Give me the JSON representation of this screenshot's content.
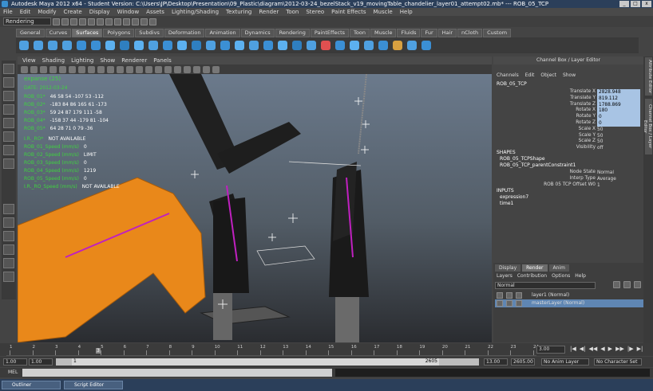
{
  "title_bar": {
    "text": "Autodesk Maya 2012 x64 - Student Version: C:\\Users\\JP\\Desktop\\Presentation\\09_Plastic\\diagram\\2012-03-24_bezelStack_v19_movingTable_chandelier_layer01_attempt02.mb* --- ROB_05_TCP",
    "buttons": [
      "_",
      "□",
      "x"
    ]
  },
  "menu_bar": [
    "File",
    "Edit",
    "Modify",
    "Create",
    "Display",
    "Window",
    "Assets",
    "Lighting/Shading",
    "Texturing",
    "Render",
    "Toon",
    "Stereo",
    "Paint Effects",
    "Muscle",
    "Help"
  ],
  "mode_menu": {
    "value": "Rendering"
  },
  "shelf_tabs": [
    "General",
    "Curves",
    "Surfaces",
    "Polygons",
    "Subdivs",
    "Deformation",
    "Animation",
    "Dynamics",
    "Rendering",
    "PaintEffects",
    "Toon",
    "Muscle",
    "Fluids",
    "Fur",
    "Hair",
    "nCloth",
    "Custom"
  ],
  "shelf_active_tab": "Surfaces",
  "shelf_icon_colors": [
    "#4fa0e0",
    "#4fa0e0",
    "#4fa0e0",
    "#4fa0e0",
    "#3b8fd4",
    "#3b8fd4",
    "#5cb0ef",
    "#2f7fc0",
    "#5cb0ef",
    "#4fa0e0",
    "#3b8fd4",
    "#5cb0ef",
    "#2f7fc0",
    "#4fa0e0",
    "#3b8fd4",
    "#5cb0ef",
    "#4fa0e0",
    "#3b8fd4",
    "#5cb0ef",
    "#2f7fc0",
    "#4fa0e0",
    "#e05050",
    "#3b8fd4",
    "#5cb0ef",
    "#4fa0e0",
    "#3b8fd4",
    "#d8a040",
    "#4fa0e0",
    "#3b8fd4"
  ],
  "panel_menu": [
    "View",
    "Shading",
    "Lighting",
    "Show",
    "Renderer",
    "Panels"
  ],
  "hud": {
    "title": "expanse (25)",
    "date": "DATE: 2012-03-24",
    "rob_rows": [
      {
        "label": "ROB_01*",
        "values": "46   58   54   -107   53   -112"
      },
      {
        "label": "ROB_02*",
        "values": "-183   84   86   165   61   -173"
      },
      {
        "label": "ROB_03*",
        "values": "59   24   87   179   111   -58"
      },
      {
        "label": "ROB_04*",
        "values": "-158   37   44   -179   81   -104"
      },
      {
        "label": "ROB_05*",
        "values": "64   28   71   0   79   -36"
      }
    ],
    "status_rows": [
      {
        "label": "I.R._RO*",
        "value": "NOT AVAILABLE"
      },
      {
        "label": "ROB_01_Speed (mm/s)",
        "value": "0"
      },
      {
        "label": "ROB_02_Speed (mm/s)",
        "value": "LIMIT"
      },
      {
        "label": "ROB_03_Speed (mm/s)",
        "value": "0"
      },
      {
        "label": "ROB_04_Speed (mm/s)",
        "value": "1219"
      },
      {
        "label": "ROB_05_Speed (mm/s)",
        "value": "0"
      },
      {
        "label": "I.R._RO_Speed (mm/s)",
        "value": "NOT AVAILABLE"
      }
    ]
  },
  "channel_box": {
    "header": "Channel Box / Layer Editor",
    "menu": [
      "Channels",
      "Edit",
      "Object",
      "Show"
    ],
    "object_name": "ROB_05_TCP",
    "channels": [
      {
        "label": "Translate X",
        "value": "2828.948",
        "highlight": true
      },
      {
        "label": "Translate Y",
        "value": "819.112",
        "highlight": true
      },
      {
        "label": "Translate Z",
        "value": "1788.869",
        "highlight": true
      },
      {
        "label": "Rotate X",
        "value": "180",
        "highlight": true
      },
      {
        "label": "Rotate Y",
        "value": "0",
        "highlight": true
      },
      {
        "label": "Rotate Z",
        "value": "0",
        "highlight": true
      },
      {
        "label": "Scale X",
        "value": "50",
        "highlight": false
      },
      {
        "label": "Scale Y",
        "value": "50",
        "highlight": false
      },
      {
        "label": "Scale Z",
        "value": "50",
        "highlight": false
      },
      {
        "label": "Visibility",
        "value": "off",
        "highlight": false
      }
    ],
    "shapes_header": "SHAPES",
    "shapes": [
      "ROB_05_TCPShape",
      "ROB_05_TCP_parentConstraint1"
    ],
    "constraint_attrs": [
      {
        "label": "Node State",
        "value": "Normal"
      },
      {
        "label": "Interp Type",
        "value": "Average"
      },
      {
        "label": "ROB 05 TCP Offset W0",
        "value": "1"
      }
    ],
    "inputs_header": "INPUTS",
    "inputs": [
      "expression7",
      "time1"
    ]
  },
  "layer_editor": {
    "tabs": [
      "Display",
      "Render",
      "Anim"
    ],
    "active_tab": "Render",
    "menu": [
      "Layers",
      "Contribution",
      "Options",
      "Help"
    ],
    "mode": "Normal",
    "layers": [
      {
        "name": "layer1 (Normal)",
        "selected": false
      },
      {
        "name": "masterLayer (Normal)",
        "selected": true
      }
    ]
  },
  "side_tabs": [
    "Attribute Editor",
    "Channel Box / Layer Editor"
  ],
  "timeline": {
    "ticks": [
      "1",
      "2",
      "3",
      "4",
      "5",
      "6",
      "7",
      "8",
      "9",
      "10",
      "11",
      "12",
      "13",
      "14",
      "15",
      "16",
      "17",
      "18",
      "19",
      "20",
      "21",
      "22",
      "23",
      "24"
    ],
    "current_frame_marker": "3",
    "current_frame": "3.00",
    "playback_buttons": [
      "|◀",
      "◀|",
      "◀◀",
      "◀",
      "▶",
      "▶▶",
      "|▶",
      "▶|"
    ]
  },
  "range_slider": {
    "start": "1.00",
    "playback_start": "1.00",
    "start_marker": "1",
    "end_marker": "2605",
    "playback_end": "13.00",
    "end": "2605.00",
    "anim_layer": "No Anim Layer",
    "character_set": "No Character Set"
  },
  "command_line": {
    "label": "MEL"
  },
  "taskbar": {
    "items": [
      "Outliner",
      "Script Editor"
    ]
  }
}
